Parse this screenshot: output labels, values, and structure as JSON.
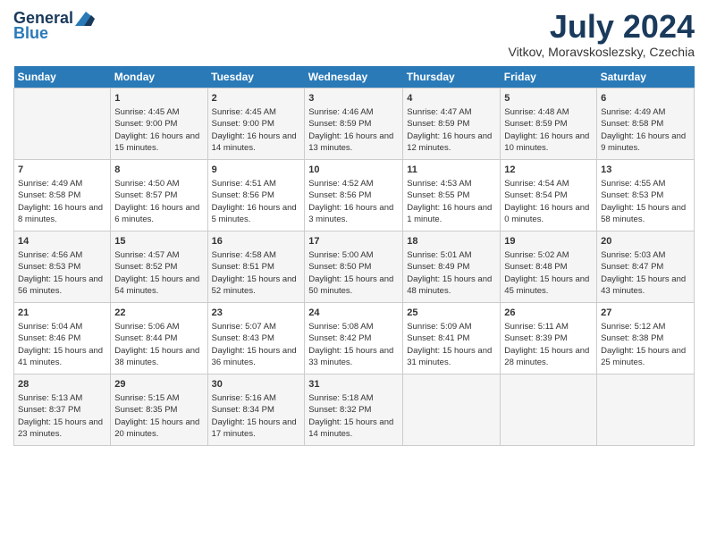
{
  "logo": {
    "line1": "General",
    "line2": "Blue"
  },
  "title": {
    "month_year": "July 2024",
    "location": "Vitkov, Moravskoslezsky, Czechia"
  },
  "headers": [
    "Sunday",
    "Monday",
    "Tuesday",
    "Wednesday",
    "Thursday",
    "Friday",
    "Saturday"
  ],
  "weeks": [
    [
      {
        "day": "",
        "content": ""
      },
      {
        "day": "1",
        "content": "Sunrise: 4:45 AM\nSunset: 9:00 PM\nDaylight: 16 hours and 15 minutes."
      },
      {
        "day": "2",
        "content": "Sunrise: 4:45 AM\nSunset: 9:00 PM\nDaylight: 16 hours and 14 minutes."
      },
      {
        "day": "3",
        "content": "Sunrise: 4:46 AM\nSunset: 8:59 PM\nDaylight: 16 hours and 13 minutes."
      },
      {
        "day": "4",
        "content": "Sunrise: 4:47 AM\nSunset: 8:59 PM\nDaylight: 16 hours and 12 minutes."
      },
      {
        "day": "5",
        "content": "Sunrise: 4:48 AM\nSunset: 8:59 PM\nDaylight: 16 hours and 10 minutes."
      },
      {
        "day": "6",
        "content": "Sunrise: 4:49 AM\nSunset: 8:58 PM\nDaylight: 16 hours and 9 minutes."
      }
    ],
    [
      {
        "day": "7",
        "content": "Sunrise: 4:49 AM\nSunset: 8:58 PM\nDaylight: 16 hours and 8 minutes."
      },
      {
        "day": "8",
        "content": "Sunrise: 4:50 AM\nSunset: 8:57 PM\nDaylight: 16 hours and 6 minutes."
      },
      {
        "day": "9",
        "content": "Sunrise: 4:51 AM\nSunset: 8:56 PM\nDaylight: 16 hours and 5 minutes."
      },
      {
        "day": "10",
        "content": "Sunrise: 4:52 AM\nSunset: 8:56 PM\nDaylight: 16 hours and 3 minutes."
      },
      {
        "day": "11",
        "content": "Sunrise: 4:53 AM\nSunset: 8:55 PM\nDaylight: 16 hours and 1 minute."
      },
      {
        "day": "12",
        "content": "Sunrise: 4:54 AM\nSunset: 8:54 PM\nDaylight: 16 hours and 0 minutes."
      },
      {
        "day": "13",
        "content": "Sunrise: 4:55 AM\nSunset: 8:53 PM\nDaylight: 15 hours and 58 minutes."
      }
    ],
    [
      {
        "day": "14",
        "content": "Sunrise: 4:56 AM\nSunset: 8:53 PM\nDaylight: 15 hours and 56 minutes."
      },
      {
        "day": "15",
        "content": "Sunrise: 4:57 AM\nSunset: 8:52 PM\nDaylight: 15 hours and 54 minutes."
      },
      {
        "day": "16",
        "content": "Sunrise: 4:58 AM\nSunset: 8:51 PM\nDaylight: 15 hours and 52 minutes."
      },
      {
        "day": "17",
        "content": "Sunrise: 5:00 AM\nSunset: 8:50 PM\nDaylight: 15 hours and 50 minutes."
      },
      {
        "day": "18",
        "content": "Sunrise: 5:01 AM\nSunset: 8:49 PM\nDaylight: 15 hours and 48 minutes."
      },
      {
        "day": "19",
        "content": "Sunrise: 5:02 AM\nSunset: 8:48 PM\nDaylight: 15 hours and 45 minutes."
      },
      {
        "day": "20",
        "content": "Sunrise: 5:03 AM\nSunset: 8:47 PM\nDaylight: 15 hours and 43 minutes."
      }
    ],
    [
      {
        "day": "21",
        "content": "Sunrise: 5:04 AM\nSunset: 8:46 PM\nDaylight: 15 hours and 41 minutes."
      },
      {
        "day": "22",
        "content": "Sunrise: 5:06 AM\nSunset: 8:44 PM\nDaylight: 15 hours and 38 minutes."
      },
      {
        "day": "23",
        "content": "Sunrise: 5:07 AM\nSunset: 8:43 PM\nDaylight: 15 hours and 36 minutes."
      },
      {
        "day": "24",
        "content": "Sunrise: 5:08 AM\nSunset: 8:42 PM\nDaylight: 15 hours and 33 minutes."
      },
      {
        "day": "25",
        "content": "Sunrise: 5:09 AM\nSunset: 8:41 PM\nDaylight: 15 hours and 31 minutes."
      },
      {
        "day": "26",
        "content": "Sunrise: 5:11 AM\nSunset: 8:39 PM\nDaylight: 15 hours and 28 minutes."
      },
      {
        "day": "27",
        "content": "Sunrise: 5:12 AM\nSunset: 8:38 PM\nDaylight: 15 hours and 25 minutes."
      }
    ],
    [
      {
        "day": "28",
        "content": "Sunrise: 5:13 AM\nSunset: 8:37 PM\nDaylight: 15 hours and 23 minutes."
      },
      {
        "day": "29",
        "content": "Sunrise: 5:15 AM\nSunset: 8:35 PM\nDaylight: 15 hours and 20 minutes."
      },
      {
        "day": "30",
        "content": "Sunrise: 5:16 AM\nSunset: 8:34 PM\nDaylight: 15 hours and 17 minutes."
      },
      {
        "day": "31",
        "content": "Sunrise: 5:18 AM\nSunset: 8:32 PM\nDaylight: 15 hours and 14 minutes."
      },
      {
        "day": "",
        "content": ""
      },
      {
        "day": "",
        "content": ""
      },
      {
        "day": "",
        "content": ""
      }
    ]
  ]
}
